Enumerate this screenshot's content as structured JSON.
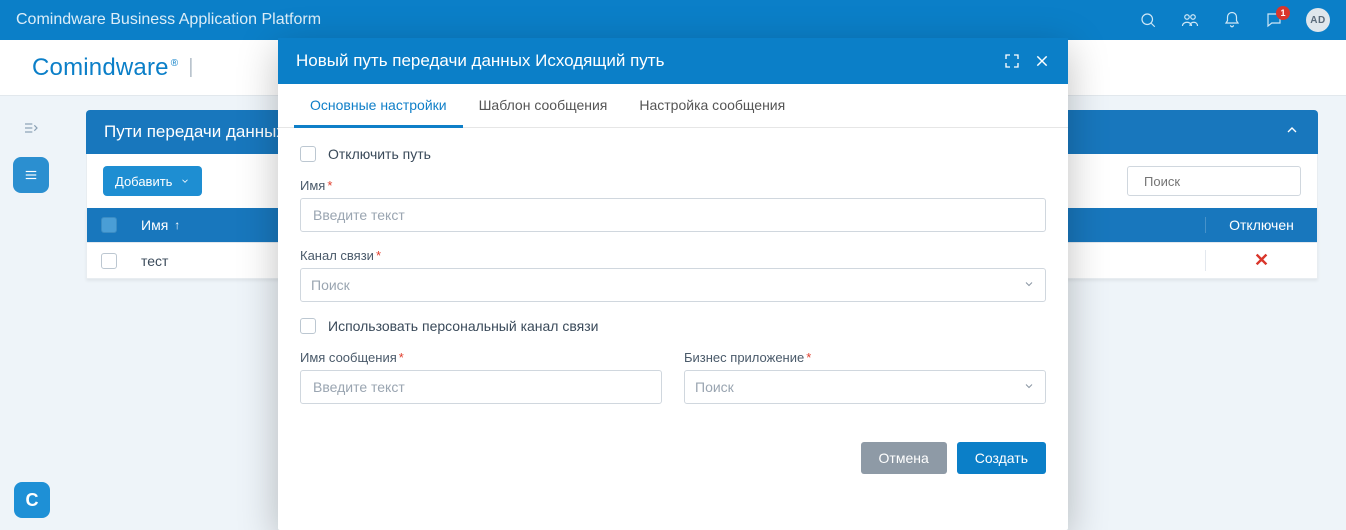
{
  "header": {
    "app_title": "Comindware Business Application Platform",
    "notification_count": "1",
    "avatar_initials": "AD"
  },
  "brand": {
    "logo_text": "Comindware",
    "logo_reg": "®"
  },
  "panel": {
    "title": "Пути передачи данных",
    "add_label": "Добавить",
    "search_placeholder": "Поиск"
  },
  "table": {
    "columns": {
      "name": "Имя",
      "disabled": "Отключен"
    },
    "rows": [
      {
        "name": "тест",
        "disabled_icon": "✕"
      }
    ]
  },
  "modal": {
    "title": "Новый путь передачи данных Исходящий путь",
    "tabs": [
      "Основные настройки",
      "Шаблон сообщения",
      "Настройка сообщения"
    ],
    "disable_path_label": "Отключить путь",
    "name_label": "Имя",
    "name_placeholder": "Введите текст",
    "channel_label": "Канал связи",
    "channel_placeholder": "Поиск",
    "personal_channel_label": "Использовать персональный канал связи",
    "message_name_label": "Имя сообщения",
    "message_name_placeholder": "Введите текст",
    "business_app_label": "Бизнес приложение",
    "business_app_placeholder": "Поиск",
    "cancel_label": "Отмена",
    "create_label": "Создать"
  }
}
